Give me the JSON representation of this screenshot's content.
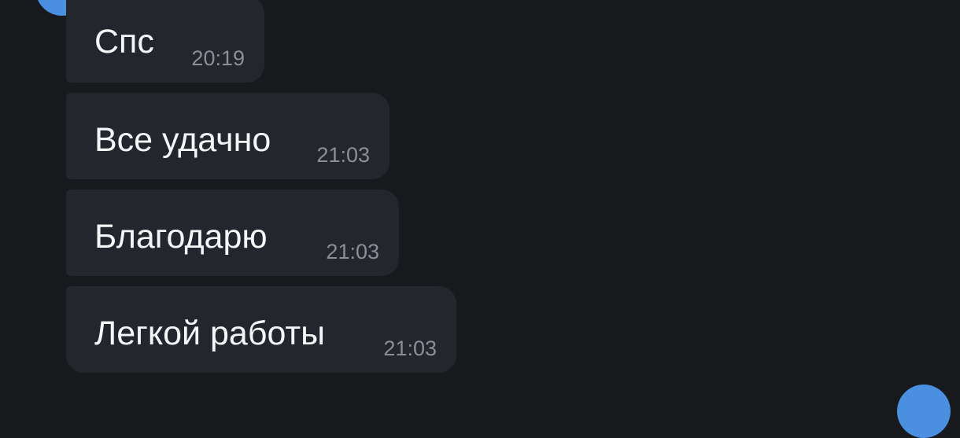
{
  "messages": [
    {
      "text": "Спс",
      "time": "20:19"
    },
    {
      "text": "Все удачно",
      "time": "21:03"
    },
    {
      "text": "Благодарю",
      "time": "21:03"
    },
    {
      "text": "Легкой работы",
      "time": "21:03"
    }
  ],
  "colors": {
    "background": "#17191d",
    "bubble": "#23262d",
    "text": "#f5f6f7",
    "time": "#8a8f98",
    "avatar": "#4a8fe0"
  }
}
